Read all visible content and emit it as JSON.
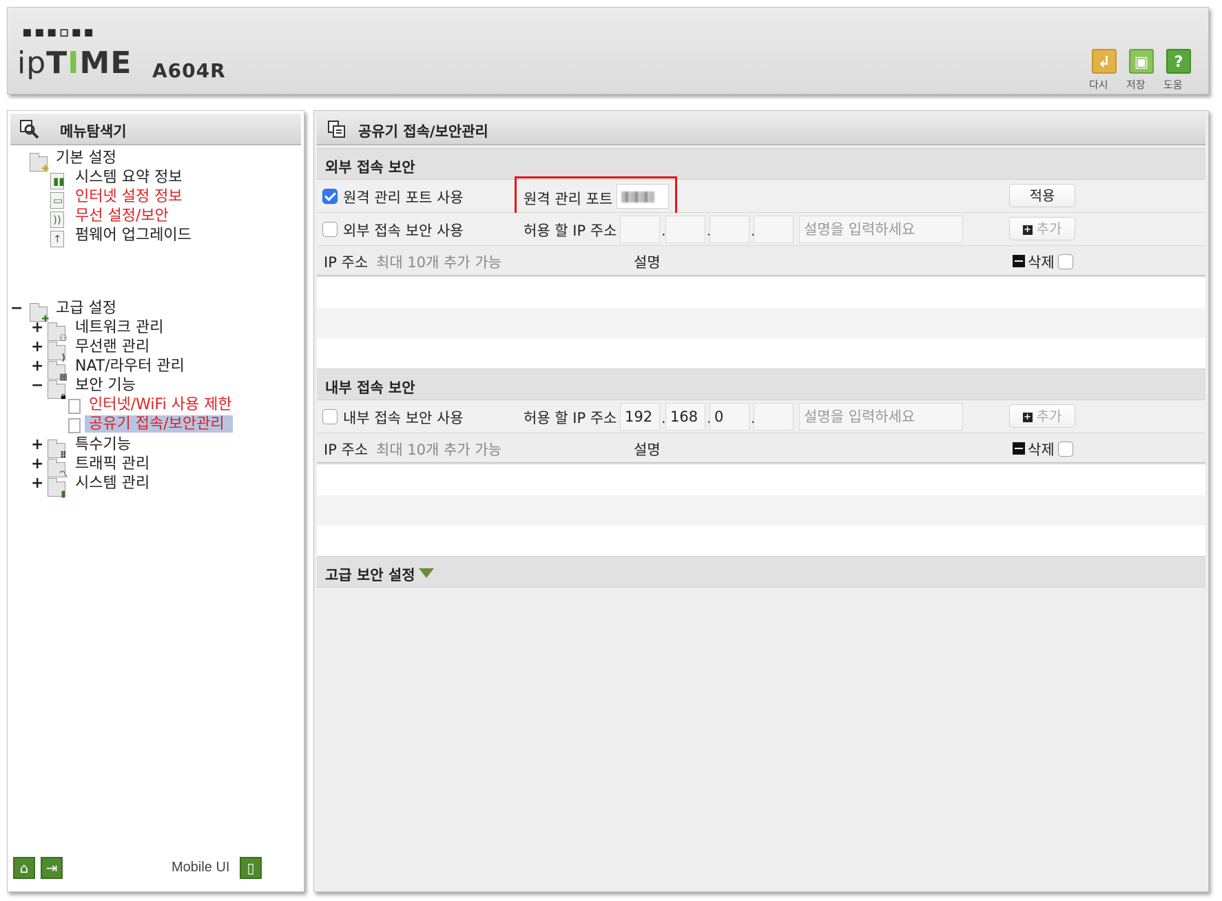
{
  "header": {
    "brand_small": "▪▪▪▫▪▪",
    "brand_ip": "ip",
    "brand_time": "TIME",
    "model": "A604R",
    "buttons": [
      {
        "label": "다시",
        "icon": "undo-icon"
      },
      {
        "label": "저장",
        "icon": "save-icon"
      },
      {
        "label": "도움",
        "icon": "help-icon"
      }
    ]
  },
  "sidebar": {
    "title": "메뉴탐색기",
    "basic": {
      "label": "기본 설정",
      "items": [
        "시스템 요약 정보",
        "인터넷 설정 정보",
        "무선 설정/보안",
        "펌웨어 업그레이드"
      ]
    },
    "advanced": {
      "sign": "−",
      "label": "고급 설정",
      "items": [
        {
          "sign": "+",
          "label": "네트워크 관리"
        },
        {
          "sign": "+",
          "label": "무선랜 관리"
        },
        {
          "sign": "+",
          "label": "NAT/라우터 관리"
        },
        {
          "sign": "−",
          "label": "보안 기능"
        },
        {
          "sign": "+",
          "label": "특수기능"
        },
        {
          "sign": "+",
          "label": "트래픽 관리"
        },
        {
          "sign": "+",
          "label": "시스템 관리"
        }
      ],
      "security_children": [
        "인터넷/WiFi 사용 제한",
        "공유기 접속/보안관리"
      ]
    },
    "footer": {
      "mobile_label": "Mobile UI"
    }
  },
  "main": {
    "title": "공유기 접속/보안관리",
    "external": {
      "title": "외부 접속 보안",
      "remote_port_enable_label": "원격 관리 포트 사용",
      "remote_port_enabled": true,
      "remote_port_label": "원격 관리 포트",
      "apply_button": "적용",
      "ext_security_label": "외부 접속 보안 사용",
      "ext_security_enabled": false,
      "allow_ip_label": "허용 할 IP 주소",
      "ip_octets": [
        "",
        "",
        "",
        ""
      ],
      "desc_placeholder": "설명을 입력하세요",
      "add_button": "추가",
      "list_ip_header": "IP 주소",
      "list_hint": "최대 10개 추가 가능",
      "list_desc_header": "설명",
      "delete_label": "삭제"
    },
    "internal": {
      "title": "내부 접속 보안",
      "int_security_label": "내부 접속 보안 사용",
      "int_security_enabled": false,
      "allow_ip_label": "허용 할 IP 주소",
      "ip_octets": [
        "192",
        "168",
        "0",
        ""
      ],
      "desc_placeholder": "설명을 입력하세요",
      "add_button": "추가",
      "list_ip_header": "IP 주소",
      "list_hint": "최대 10개 추가 가능",
      "list_desc_header": "설명",
      "delete_label": "삭제"
    },
    "advanced_security": {
      "title": "고급 보안 설정"
    }
  },
  "colors": {
    "highlight_red": "#e8141d",
    "menu_red": "#e02020",
    "selected_bg": "#b7c5e3",
    "check_blue": "#3478f6",
    "icon_green": "#4f8a2e"
  }
}
